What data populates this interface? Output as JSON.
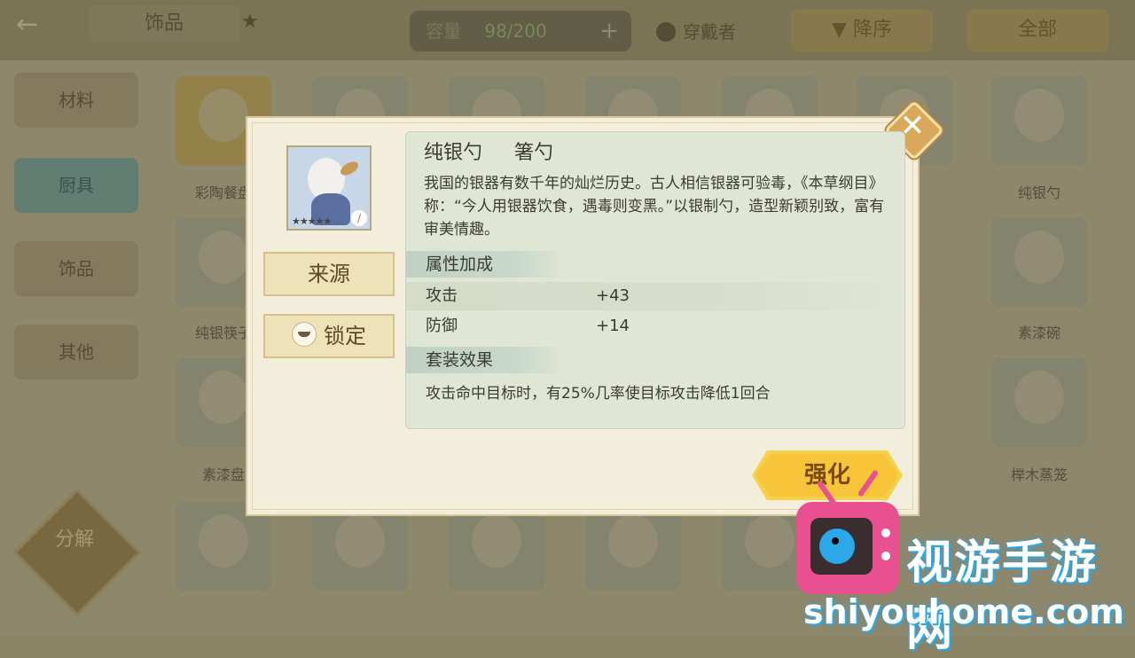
{
  "background": {
    "top_tab": "饰品",
    "capacity_label": "容量",
    "capacity_value": "98/200",
    "wearer_label": "穿戴者",
    "sort_label": "降序",
    "filter_label": "全部",
    "side_tabs": [
      "材料",
      "厨具",
      "饰品",
      "其他"
    ],
    "slot_labels": [
      "彩陶餐盘",
      "纯银勺",
      "纯银筷子",
      "素漆碗",
      "素漆盘",
      "榉木蒸笼"
    ],
    "divide_label": "分解"
  },
  "dialog": {
    "item_name": "纯银勺",
    "item_type": "箸勺",
    "description": "我国的银器有数千年的灿烂历史。古人相信银器可验毒，《本草纲目》称：“今人用银器饮食，遇毒则变黑。”以银制勺，造型新颖别致，富有审美情趣。",
    "source_button": "来源",
    "lock_button": "锁定",
    "attributes_header": "属性加成",
    "attributes": [
      {
        "name": "攻击",
        "value": "+43"
      },
      {
        "name": "防御",
        "value": "+14"
      }
    ],
    "set_header": "套装效果",
    "set_effect": "攻击命中目标时，有25%几率使目标攻击降低1回合",
    "enhance_button": "强化",
    "close_icon": "close-icon"
  },
  "watermark": {
    "name": "视游手游网",
    "url": "shiyouhome.com"
  }
}
